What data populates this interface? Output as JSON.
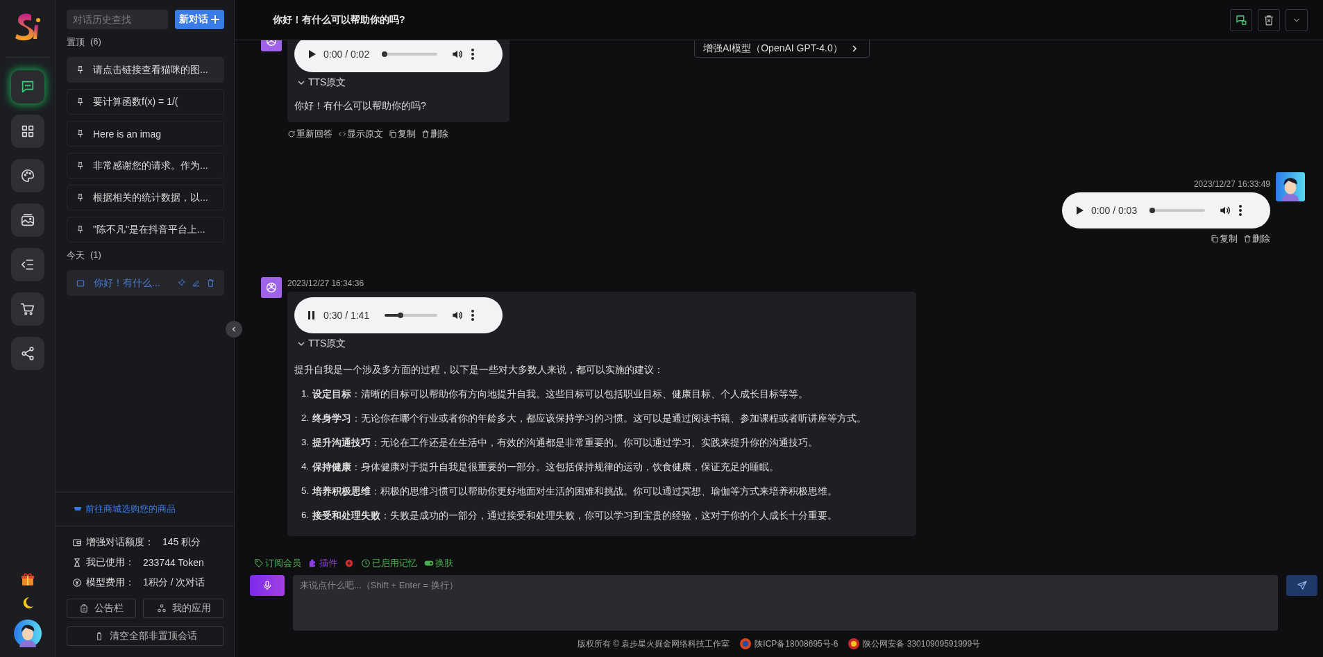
{
  "rail": {
    "items": [
      {
        "kind": "chat",
        "selected": true
      },
      {
        "kind": "apps",
        "selected": false
      },
      {
        "kind": "palette",
        "selected": false
      },
      {
        "kind": "gallery",
        "selected": false
      },
      {
        "kind": "list",
        "selected": false
      },
      {
        "kind": "cart",
        "selected": false
      },
      {
        "kind": "share",
        "selected": false
      }
    ]
  },
  "sidebar": {
    "search": {
      "placeholder": "对话历史查找"
    },
    "new_button": "新对话",
    "groups": [
      {
        "title": "置顶",
        "count": "(6)",
        "items": [
          {
            "kind": "pinned",
            "title": "请点击链接查看猫咪的图...",
            "hovered": true,
            "selected": false
          },
          {
            "kind": "pinned",
            "title": "要计算函数f(x) = 1/(",
            "hovered": false,
            "selected": false
          },
          {
            "kind": "pinned",
            "title": "Here is an imag",
            "hovered": false,
            "selected": false
          },
          {
            "kind": "pinned",
            "title": "非常感谢您的请求。作为...",
            "hovered": false,
            "selected": false
          },
          {
            "kind": "pinned",
            "title": "根据相关的统计数据，以...",
            "hovered": false,
            "selected": false
          },
          {
            "kind": "pinned",
            "title": "\"陈不凡\"是在抖音平台上...",
            "hovered": false,
            "selected": false
          }
        ]
      },
      {
        "title": "今天",
        "count": "(1)",
        "items": [
          {
            "kind": "chat",
            "title": "你好！有什么...",
            "selected": true
          }
        ]
      }
    ],
    "shop_link": "前往商城选购您的商品",
    "stats": [
      {
        "kind": "wallet",
        "label": "增强对话额度：",
        "value": "145 积分"
      },
      {
        "kind": "hourglass",
        "label": "我已使用：",
        "value": "233744 Token"
      },
      {
        "kind": "coin",
        "label": "模型费用：",
        "value": "1积分 / 次对话"
      }
    ],
    "buttons": [
      {
        "kind": "notice",
        "label": "公告栏"
      },
      {
        "kind": "apps",
        "label": "我的应用"
      }
    ],
    "clear_button": "清空全部非置顶会话"
  },
  "chat": {
    "title": "你好！有什么可以帮助你的吗?",
    "model_button": "增强AI模型（OpenAI GPT-4.0）",
    "header_buttons": [
      {
        "kind": "chat-lock"
      },
      {
        "kind": "trash"
      },
      {
        "kind": "chevron"
      }
    ],
    "messages": [
      {
        "kind": "assistant",
        "audio": {
          "time": "0:00 / 0:02",
          "level": 0,
          "playing": false
        },
        "tts_label": "TTS原文",
        "text": "你好！有什么可以帮助你的吗?",
        "actions": [
          {
            "kind": "refresh",
            "label": "重新回答"
          },
          {
            "kind": "code",
            "label": "显示原文"
          },
          {
            "kind": "copy",
            "label": "复制"
          },
          {
            "kind": "delete",
            "label": "删除"
          }
        ]
      },
      {
        "kind": "user",
        "time": "2023/12/27 16:33:49",
        "audio": {
          "time": "0:00 / 0:03",
          "level": 0,
          "playing": false
        },
        "actions": [
          {
            "kind": "copy",
            "label": "复制"
          },
          {
            "kind": "delete",
            "label": "删除"
          }
        ]
      },
      {
        "kind": "assistant",
        "time": "2023/12/27 16:34:36",
        "audio": {
          "time": "0:30 / 1:41",
          "level": 0.3,
          "playing": true
        },
        "tts_label": "TTS原文",
        "intro": "提升自我是一个涉及多方面的过程，以下是一些对大多数人来说，都可以实施的建议：",
        "list": [
          {
            "number": "1.",
            "text": "**设定目标**：清晰的目标可以帮助你有方向地提升自我。这些目标可以包括职业目标、健康目标、个人成长目标等等。"
          },
          {
            "number": "2.",
            "text": "**终身学习**：无论你在哪个行业或者你的年龄多大，都应该保持学习的习惯。这可以是通过阅读书籍、参加课程或者听讲座等方式。"
          },
          {
            "number": "3.",
            "text": "**提升沟通技巧**：无论在工作还是在生活中，有效的沟通都是非常重要的。你可以通过学习、实践来提升你的沟通技巧。"
          },
          {
            "number": "4.",
            "text": "**保持健康**：身体健康对于提升自我是很重要的一部分。这包括保持规律的运动，饮食健康，保证充足的睡眠。"
          },
          {
            "number": "5.",
            "text": "**培养积极思维**：积极的思维习惯可以帮助你更好地面对生活的困难和挑战。你可以通过冥想、瑜伽等方式来培养积极思维。"
          },
          {
            "number": "6.",
            "text": "**接受和处理失败**：失败是成功的一部分，通过接受和处理失败，你可以学习到宝贵的经验，这对于你的个人成长十分重要。"
          }
        ]
      }
    ],
    "toolbar": [
      {
        "kind": "tag",
        "label": "订阅会员",
        "color": "#4caf50"
      },
      {
        "kind": "plugin",
        "label": "插件",
        "color": "#8b3fe0"
      },
      {
        "kind": "logo",
        "color": "#d32f2f"
      },
      {
        "kind": "memory",
        "label": "已启用记忆",
        "color": "#4caf50"
      },
      {
        "kind": "toggle",
        "label": "换肤",
        "color": "#4caf50"
      }
    ],
    "input": {
      "placeholder": "来说点什么吧...（Shift + Enter = 换行）"
    }
  },
  "footer": {
    "copyright": "版权所有 © 袁步星火掘金网络科技工作室",
    "icp": "陕ICP备18008695号-6",
    "police": "陕公网安备 33010909591999号"
  }
}
